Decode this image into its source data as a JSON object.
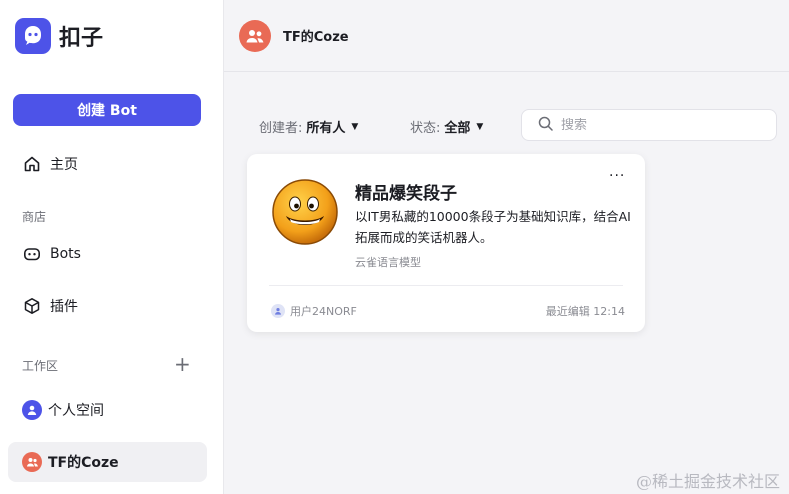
{
  "app": {
    "logo_text": "扣子",
    "create_button": "创建 Bot"
  },
  "sidebar": {
    "home_label": "主页",
    "store_section": "商店",
    "bots_label": "Bots",
    "plugins_label": "插件",
    "workspace_section": "工作区",
    "personal_space": "个人空间",
    "team_space": "TF的Coze"
  },
  "topbar": {
    "team_name": "TF的Coze"
  },
  "filters": {
    "creator_label": "创建者:",
    "creator_value": "所有人",
    "status_label": "状态:",
    "status_value": "全部",
    "search_placeholder": "搜索"
  },
  "card": {
    "title": "精品爆笑段子",
    "description": "以IT男私藏的10000条段子为基础知识库，结合AI拓展而成的笑话机器人。",
    "model": "云雀语言模型",
    "user": "用户24NORF",
    "edited": "最近编辑 12:14",
    "more": "···"
  },
  "watermark": "@稀土掘金技术社区",
  "colors": {
    "brand": "#4d53e8",
    "team_avatar": "#e96a55"
  }
}
